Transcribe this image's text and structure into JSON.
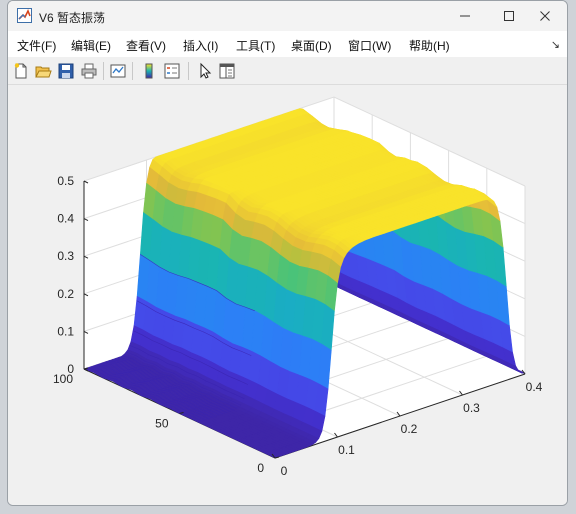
{
  "window": {
    "title": "V6 暂态振荡"
  },
  "menu": [
    "文件(F)",
    "编辑(E)",
    "查看(V)",
    "插入(I)",
    "工具(T)",
    "桌面(D)",
    "窗口(W)",
    "帮助(H)"
  ],
  "toolbar": [
    "new-figure-icon",
    "open-icon",
    "save-icon",
    "print-icon",
    "link-plot-icon",
    "colorbar-icon",
    "legend-icon",
    "edit-plot-arrow-icon",
    "property-inspector-icon"
  ],
  "colors": {
    "low": "#3e26a8",
    "mid": "#1ab2b0",
    "high": "#f9e32a"
  },
  "chart_data": {
    "type": "surface",
    "z_ticks": [
      "0",
      "0.1",
      "0.2",
      "0.3",
      "0.4",
      "0.5"
    ],
    "x_ticks": [
      "0",
      "0.1",
      "0.2",
      "0.3",
      "0.4"
    ],
    "y_ticks": [
      "0",
      "50",
      "100"
    ],
    "zlim": [
      0,
      0.5
    ],
    "xlim": [
      0,
      0.4
    ],
    "ylim": [
      0,
      100
    ],
    "grid": true,
    "colormap": "parula"
  }
}
